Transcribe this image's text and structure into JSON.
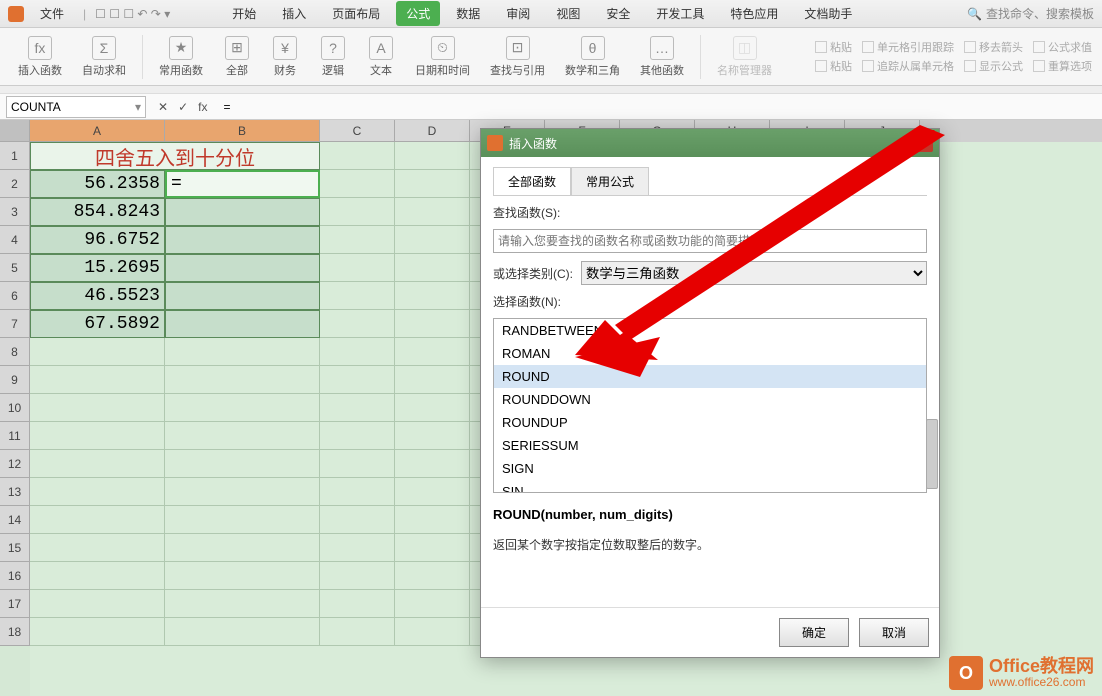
{
  "menubar": {
    "file": "文件",
    "items": [
      "开始",
      "插入",
      "页面布局",
      "公式",
      "数据",
      "审阅",
      "视图",
      "安全",
      "开发工具",
      "特色应用",
      "文档助手"
    ],
    "active_index": 3,
    "search_placeholder": "查找命令、搜索模板"
  },
  "ribbon": {
    "groups": [
      {
        "icon": "fx",
        "label": "插入函数"
      },
      {
        "icon": "Σ",
        "label": "自动求和"
      },
      {
        "icon": "★",
        "label": "常用函数"
      },
      {
        "icon": "⊞",
        "label": "全部"
      },
      {
        "icon": "¥",
        "label": "财务"
      },
      {
        "icon": "?",
        "label": "逻辑"
      },
      {
        "icon": "A",
        "label": "文本"
      },
      {
        "icon": "⏲",
        "label": "日期和时间"
      },
      {
        "icon": "⊡",
        "label": "查找与引用"
      },
      {
        "icon": "θ",
        "label": "数学和三角"
      },
      {
        "icon": "…",
        "label": "其他函数"
      },
      {
        "icon": "◫",
        "label": "名称管理器"
      }
    ],
    "right_items": [
      [
        "粘贴",
        "单元格引用跟踪",
        "移去箭头",
        "公式求值"
      ],
      [
        "粘贴",
        "追踪从属单元格",
        "显示公式",
        "重算选项"
      ]
    ]
  },
  "name_box": "COUNTA",
  "formula_value": "=",
  "columns": [
    "A",
    "B",
    "C",
    "D",
    "E",
    "F",
    "G",
    "H",
    "I",
    "J"
  ],
  "col_widths": {
    "A": 135,
    "B": 155
  },
  "rows_visible": 18,
  "merged_header": "四舍五入到十分位",
  "table_data": [
    {
      "A": "56.2358",
      "B": "="
    },
    {
      "A": "854.8243",
      "B": ""
    },
    {
      "A": "96.6752",
      "B": ""
    },
    {
      "A": "15.2695",
      "B": ""
    },
    {
      "A": "46.5523",
      "B": ""
    },
    {
      "A": "67.5892",
      "B": ""
    }
  ],
  "active_cell": "B2",
  "dialog": {
    "title": "插入函数",
    "tabs": [
      "全部函数",
      "常用公式"
    ],
    "active_tab": 0,
    "search_label": "查找函数(S):",
    "search_placeholder": "请输入您要查找的函数名称或函数功能的简要描述…",
    "category_label": "或选择类别(C):",
    "category_value": "数学与三角函数",
    "select_label": "选择函数(N):",
    "functions": [
      "RANDBETWEEN",
      "ROMAN",
      "ROUND",
      "ROUNDDOWN",
      "ROUNDUP",
      "SERIESSUM",
      "SIGN",
      "SIN"
    ],
    "selected_index": 2,
    "signature": "ROUND(number, num_digits)",
    "description": "返回某个数字按指定位数取整后的数字。",
    "ok": "确定",
    "cancel": "取消"
  },
  "watermark": {
    "line1": "Office教程网",
    "line2": "www.office26.com",
    "icon": "O"
  }
}
